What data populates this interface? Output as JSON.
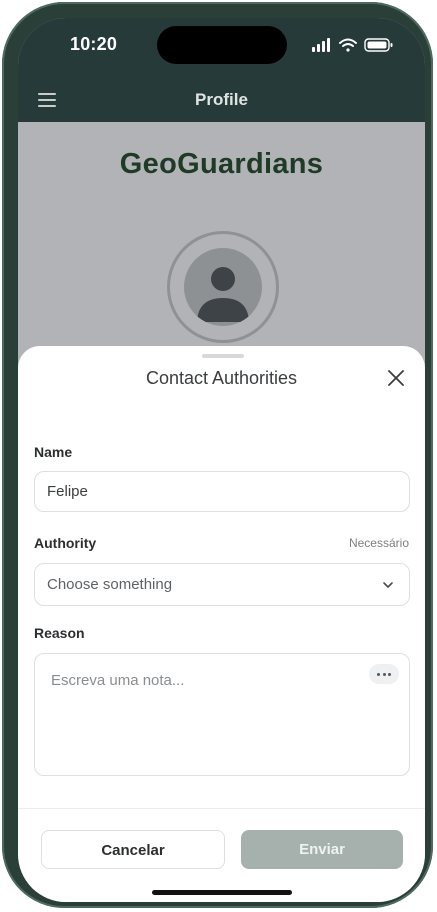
{
  "status_bar": {
    "time": "10:20",
    "icons": [
      "signal-icon",
      "wifi-icon",
      "battery-icon"
    ]
  },
  "nav": {
    "title": "Profile",
    "menu_icon": "menu-icon"
  },
  "profile": {
    "brand": "GeoGuardians",
    "avatar_icon": "user-avatar-icon"
  },
  "sheet": {
    "title": "Contact Authorities",
    "close_icon": "close-icon",
    "name": {
      "label": "Name",
      "value": "Felipe"
    },
    "authority": {
      "label": "Authority",
      "required": "Necessário",
      "placeholder": "Choose something",
      "chevron_icon": "chevron-down-icon"
    },
    "reason": {
      "label": "Reason",
      "placeholder": "Escreva uma nota...",
      "more_icon": "more-dots-icon"
    },
    "cancel_label": "Cancelar",
    "send_label": "Enviar"
  },
  "colors": {
    "header": "#253a39",
    "brand": "#1f3a26",
    "send_disabled": "#a6b1ae",
    "backdrop": "#b1b3b6"
  }
}
